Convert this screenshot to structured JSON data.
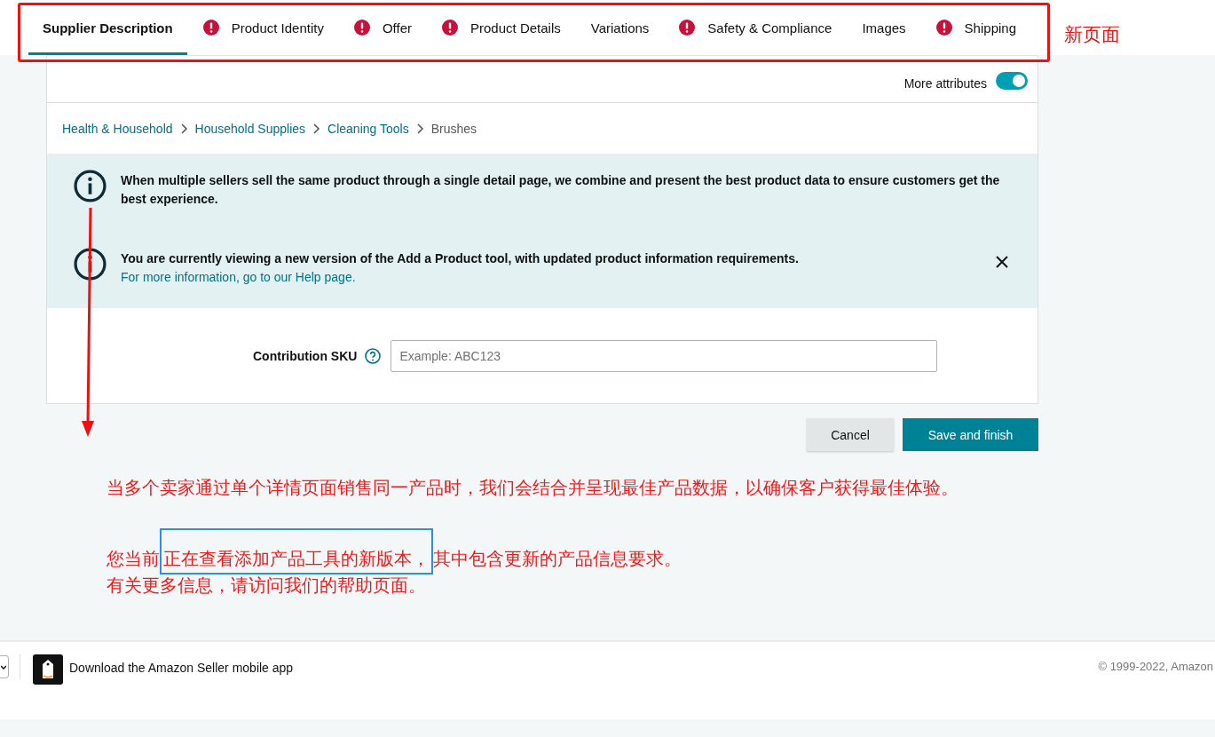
{
  "tabs": [
    {
      "label": "Supplier Description",
      "selected": true,
      "error": false
    },
    {
      "label": "Product Identity",
      "selected": false,
      "error": true
    },
    {
      "label": "Offer",
      "selected": false,
      "error": true
    },
    {
      "label": "Product Details",
      "selected": false,
      "error": true
    },
    {
      "label": "Variations",
      "selected": false,
      "error": false
    },
    {
      "label": "Safety & Compliance",
      "selected": false,
      "error": true
    },
    {
      "label": "Images",
      "selected": false,
      "error": false
    },
    {
      "label": "Shipping",
      "selected": false,
      "error": true
    }
  ],
  "annotation_label": "新页面",
  "more_attributes": {
    "label": "More attributes",
    "on": true
  },
  "breadcrumb": [
    {
      "label": "Health & Household",
      "kind": "link"
    },
    {
      "label": "Household Supplies",
      "kind": "link"
    },
    {
      "label": "Cleaning Tools",
      "kind": "link"
    },
    {
      "label": "Brushes",
      "kind": "current"
    }
  ],
  "notices": [
    {
      "text": "When multiple sellers sell the same product through a single detail page, we combine and present the best product data to ensure customers get the best experience.",
      "dismissible": false
    },
    {
      "text": "You are currently viewing a new version of the Add a Product tool, with updated product information requirements.",
      "link": "For more information, go to our Help page.",
      "dismissible": true
    }
  ],
  "contribution_sku": {
    "label": "Contribution SKU",
    "placeholder": "Example: ABC123"
  },
  "buttons": [
    {
      "label": "Cancel",
      "kind": "secondary"
    },
    {
      "label": "Save and finish",
      "kind": "primary"
    }
  ],
  "translations": [
    {
      "kind": "plain",
      "text": "当多个卖家通过单个详情页面销售同一产品时，我们会结合并呈现最佳产品数据，以确保客户获得最佳体验。"
    },
    {
      "kind": "highlighted",
      "before": "您当前",
      "highlight": "正在查看添加产品工具的新版本，",
      "after": "其中包含更新的产品信息要求。"
    },
    {
      "kind": "plain",
      "text": "有关更多信息，请访问我们的帮助页面。"
    }
  ],
  "footer": {
    "app_text": "Download the Amazon Seller mobile app",
    "copyright": "© 1999-2022, Amazon"
  }
}
